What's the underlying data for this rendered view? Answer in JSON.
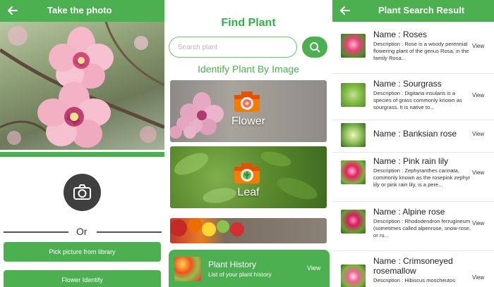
{
  "take_photo": {
    "title": "Take the photo",
    "or_label": "Or",
    "library_button": "Pick picture from library",
    "identify_button": "Flower Identify",
    "back_icon": "arrow-back-icon",
    "camera_icon": "camera-icon",
    "accent": "#4caf50"
  },
  "find_plant": {
    "title": "Find Plant",
    "search": {
      "placeholder": "Search plant",
      "value": ""
    },
    "search_icon": "search-icon",
    "subtitle": "Identify Plant By Image",
    "categories": [
      {
        "label": "Flower",
        "icon": "camera-icon"
      },
      {
        "label": "Leaf",
        "icon": "camera-icon"
      }
    ],
    "history": {
      "title": "Plant History",
      "subtitle": "List of your plant history",
      "view_label": "View"
    }
  },
  "results": {
    "title": "Plant Search Result",
    "items": [
      {
        "name": "Name : Roses",
        "desc": "Description : Rose is a woody perennial flowering plant of the genus Rosa, in the family Rosa...",
        "view": "View"
      },
      {
        "name": "Name : Sourgrass",
        "desc": "Description : Digitaria insularis is a species of grass commonly known as sourgrass. It is native to...",
        "view": "View"
      },
      {
        "name": "Name : Banksian rose",
        "desc": "",
        "view": "View"
      },
      {
        "name": "Name : Pink rain lily",
        "desc": "Description : Zephyranthes carinata, commonly known as the rosepink zephyr lily or pink rain lily, is a pere...",
        "view": "View"
      },
      {
        "name": "Name : Alpine rose",
        "desc": "Description : Rhododendron ferrugineum (sometimes called alpenrose, snow-rose, or ru...",
        "view": "View"
      },
      {
        "name": "Name : Crimsoneyed rosemallow",
        "desc": "Description : Hibiscus moscheutos",
        "view": "View"
      }
    ]
  }
}
